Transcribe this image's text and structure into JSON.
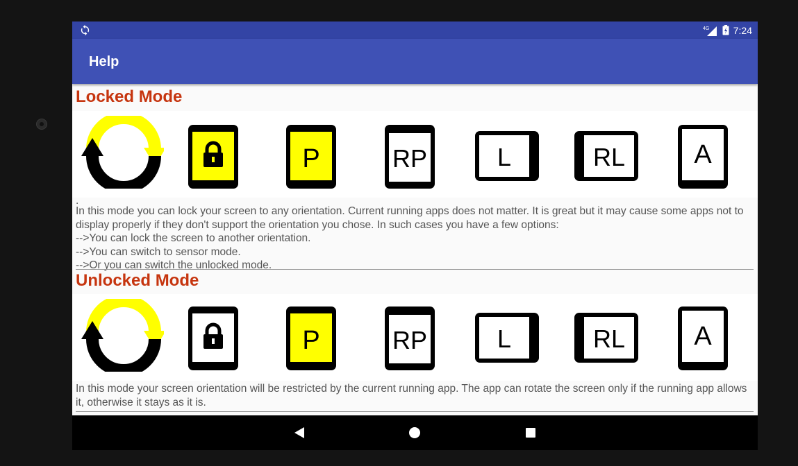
{
  "status": {
    "network": "4G",
    "time": "7:24"
  },
  "appbar": {
    "title": "Help"
  },
  "locked": {
    "title": "Locked Mode",
    "icons": [
      "P",
      "RP",
      "L",
      "RL",
      "A"
    ],
    "dot": ".",
    "lines": [
      "In this mode you can lock your screen to any orientation. Current running apps does not matter. It is great but it may cause some apps not to display properly if they don't support the orientation you chose. In such cases you have a few options:",
      "-->You can lock the screen to another orientation.",
      "-->You can switch to sensor mode.",
      "-->Or you can switch the unlocked mode."
    ]
  },
  "unlocked": {
    "title": "Unlocked Mode",
    "icons": [
      "P",
      "RP",
      "L",
      "RL",
      "A"
    ],
    "lines": [
      "In this mode your screen orientation will be restricted by the current running app. The app can rotate the screen only if the running app allows it, otherwise it stays as it is."
    ]
  },
  "colors": {
    "status_bar": "#3344a5",
    "app_bar": "#3f51b5",
    "heading": "#c6350f",
    "highlight": "#ffff00"
  }
}
